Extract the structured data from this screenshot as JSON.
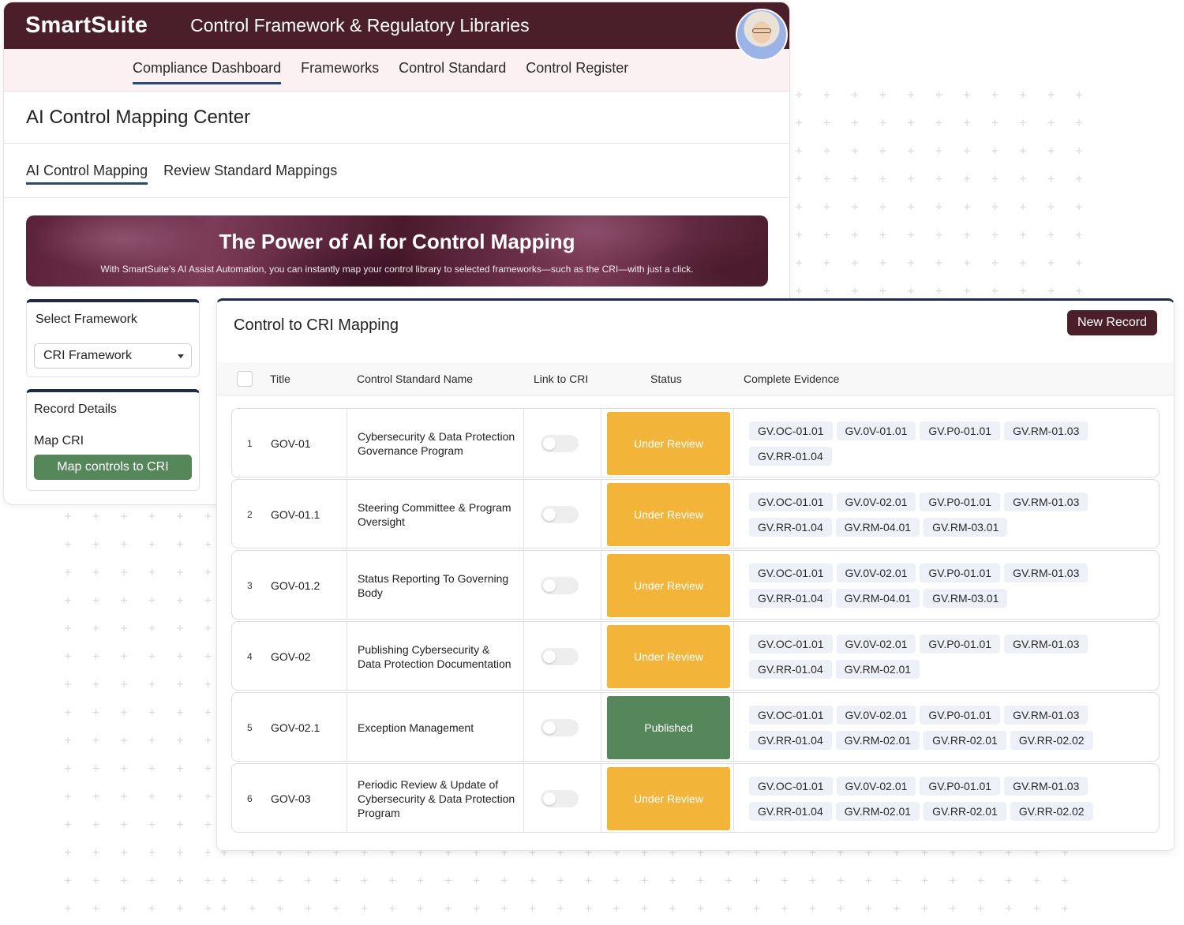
{
  "app": {
    "logo": "SmartSuite",
    "title": "Control Framework & Regulatory Libraries",
    "nav": [
      "Compliance Dashboard",
      "Frameworks",
      "Control Standard",
      "Control Register"
    ],
    "active_nav": "Compliance Dashboard"
  },
  "page": {
    "title": "AI Control Mapping Center",
    "tabs": [
      "AI Control Mapping",
      "Review Standard Mappings"
    ],
    "active_tab": "AI Control Mapping"
  },
  "banner": {
    "title": "The Power of AI for Control Mapping",
    "subtitle": "With SmartSuite's AI Assist Automation, you can instantly map your control library to selected frameworks—such as the CRI—with just a click."
  },
  "select_framework": {
    "label": "Select Framework",
    "value": "CRI Framework"
  },
  "record_details": {
    "label": "Record Details",
    "sub_label": "Map CRI",
    "button": "Map controls to CRI"
  },
  "panel": {
    "title": "Control to CRI Mapping",
    "new_button": "New Record",
    "columns": [
      "Title",
      "Control Standard Name",
      "Link to CRI",
      "Status",
      "Complete Evidence"
    ],
    "rows": [
      {
        "num": "1",
        "title": "GOV-01",
        "name": "Cybersecurity & Data Protection Governance Program",
        "linked": false,
        "status": "Under Review",
        "evidence": [
          "GV.OC-01.01",
          "GV.0V-01.01",
          "GV.P0-01.01",
          "GV.RM-01.03",
          "GV.RR-01.04"
        ]
      },
      {
        "num": "2",
        "title": "GOV-01.1",
        "name": "Steering Committee & Program Oversight",
        "linked": false,
        "status": "Under Review",
        "evidence": [
          "GV.OC-01.01",
          "GV.0V-02.01",
          "GV.P0-01.01",
          "GV.RM-01.03",
          "GV.RR-01.04",
          "GV.RM-04.01",
          "GV.RM-03.01"
        ]
      },
      {
        "num": "3",
        "title": "GOV-01.2",
        "name": "Status Reporting To Governing Body",
        "linked": false,
        "status": "Under Review",
        "evidence": [
          "GV.OC-01.01",
          "GV.0V-02.01",
          "GV.P0-01.01",
          "GV.RM-01.03",
          "GV.RR-01.04",
          "GV.RM-04.01",
          "GV.RM-03.01"
        ]
      },
      {
        "num": "4",
        "title": "GOV-02",
        "name": "Publishing Cybersecurity & Data Protection Documentation",
        "linked": false,
        "status": "Under Review",
        "evidence": [
          "GV.OC-01.01",
          "GV.0V-02.01",
          "GV.P0-01.01",
          "GV.RM-01.03",
          "GV.RR-01.04",
          "GV.RM-02.01"
        ]
      },
      {
        "num": "5",
        "title": "GOV-02.1",
        "name": "Exception Management",
        "linked": false,
        "status": "Published",
        "evidence": [
          "GV.OC-01.01",
          "GV.0V-02.01",
          "GV.P0-01.01",
          "GV.RM-01.03",
          "GV.RR-01.04",
          "GV.RM-02.01",
          "GV.RR-02.01",
          "GV.RR-02.02"
        ]
      },
      {
        "num": "6",
        "title": "GOV-03",
        "name": "Periodic Review & Update of Cybersecurity & Data Protection Program",
        "linked": false,
        "status": "Under Review",
        "evidence": [
          "GV.OC-01.01",
          "GV.0V-02.01",
          "GV.P0-01.01",
          "GV.RM-01.03",
          "GV.RR-01.04",
          "GV.RM-02.01",
          "GV.RR-02.01",
          "GV.RR-02.02"
        ]
      }
    ]
  },
  "colors": {
    "brand": "#4a1f2a",
    "under_review": "#f3b43a",
    "published": "#56875a",
    "chip": "#eef0f7"
  }
}
